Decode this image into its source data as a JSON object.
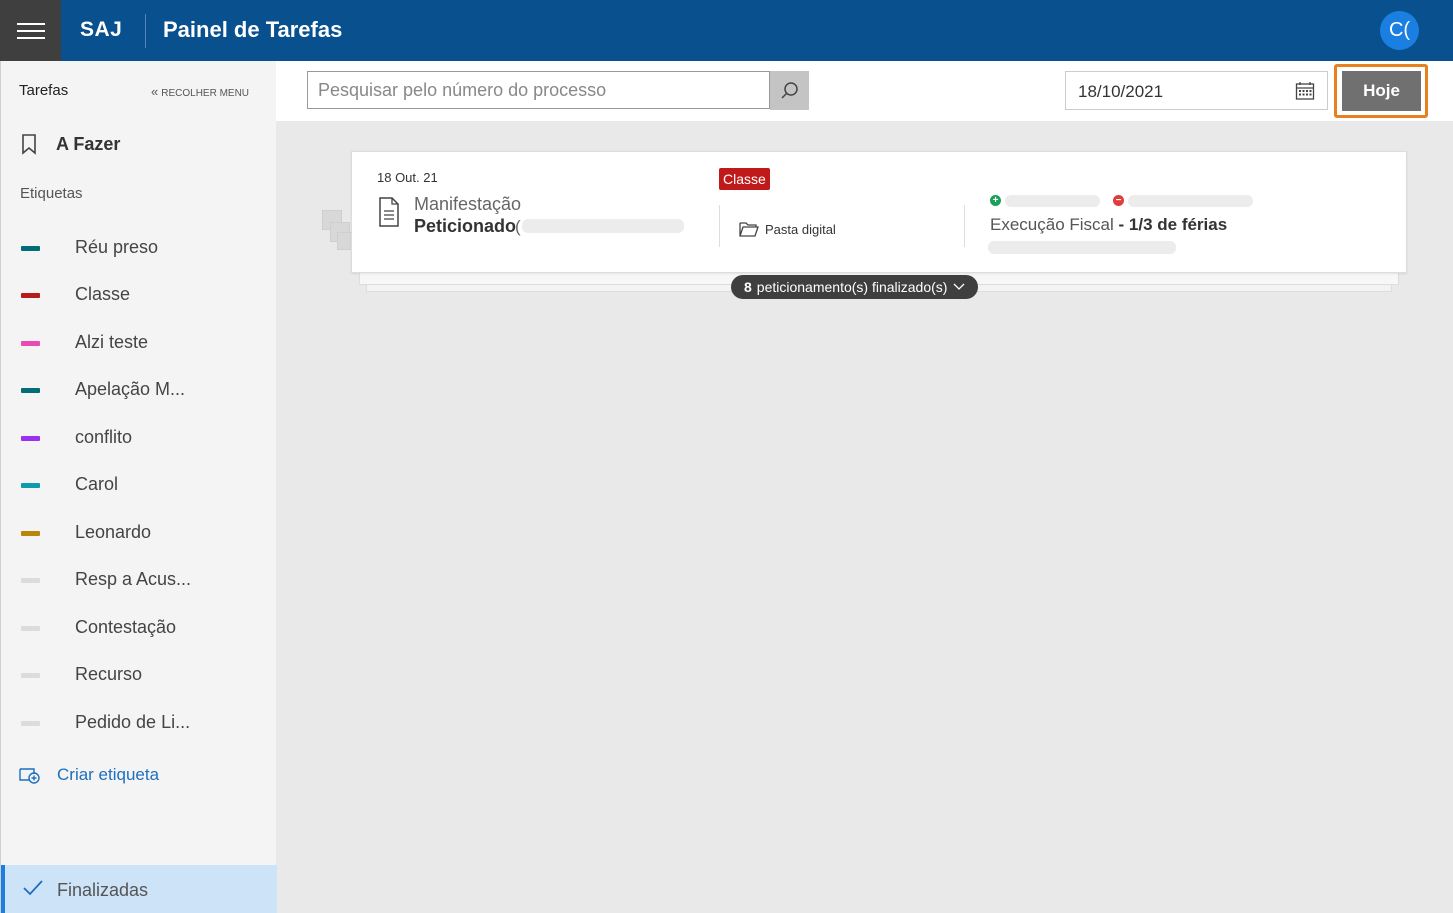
{
  "header": {
    "brand": "SAJ",
    "title": "Painel de Tarefas",
    "avatar_initials": "C("
  },
  "sidebar": {
    "heading": "Tarefas",
    "collapse_label": "RECOLHER MENU",
    "todo_label": "A Fazer",
    "tags_heading": "Etiquetas",
    "tags": [
      {
        "label": "Réu preso",
        "color": "#006d77"
      },
      {
        "label": "Classe",
        "color": "#b71c1c"
      },
      {
        "label": "Alzi teste",
        "color": "#e94ab4"
      },
      {
        "label": "Apelação M...",
        "color": "#006d77"
      },
      {
        "label": "conflito",
        "color": "#9b30f2"
      },
      {
        "label": "Carol",
        "color": "#0f9bab"
      },
      {
        "label": "Leonardo",
        "color": "#b8860b"
      },
      {
        "label": "Resp a Acus...",
        "color": "#dcdcdc"
      },
      {
        "label": "Contestação",
        "color": "#dcdcdc"
      },
      {
        "label": "Recurso",
        "color": "#dcdcdc"
      },
      {
        "label": "Pedido de Li...",
        "color": "#dcdcdc"
      }
    ],
    "create_tag_label": "Criar etiqueta",
    "finalized_label": "Finalizadas"
  },
  "toolbar": {
    "search_placeholder": "Pesquisar pelo número do processo",
    "date_value": "18/10/2021",
    "today_label": "Hoje",
    "highlight_color": "#e8801d"
  },
  "card": {
    "date": "18 Out. 21",
    "type": "Manifestação",
    "status": "Peticionado",
    "paren": "(",
    "badge": "Classe",
    "badge_color": "#c01919",
    "folder_label": "Pasta digital",
    "exec_class": "Execução Fiscal",
    "exec_detail": "- 1/3 de férias",
    "finalized_count": "8",
    "finalized_text": "peticionamento(s) finalizado(s)"
  }
}
